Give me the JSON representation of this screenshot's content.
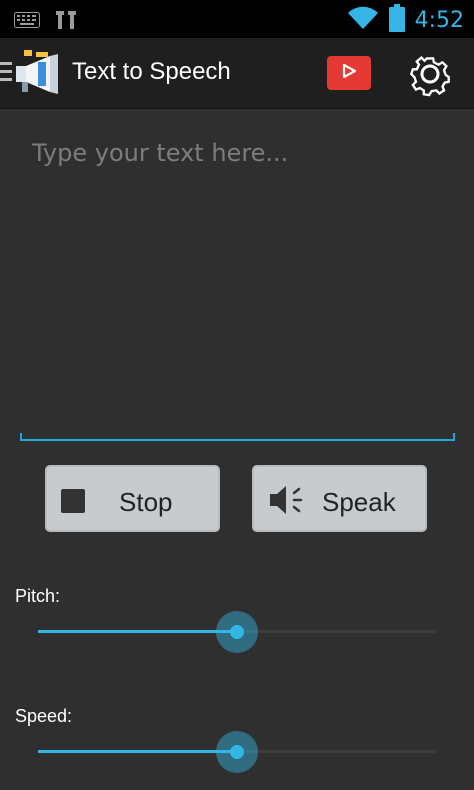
{
  "status": {
    "time": "4:52",
    "icons": [
      "keyboard-icon",
      "usb-debug-icon",
      "wifi-icon",
      "battery-icon"
    ],
    "accent": "#34b5e5"
  },
  "toolbar": {
    "title": "Text to Speech",
    "youtube_color": "#e53935"
  },
  "editor": {
    "placeholder": "Type your text here...",
    "value": "",
    "accent": "#1fa8dc"
  },
  "buttons": {
    "stop_label": "Stop",
    "speak_label": "Speak"
  },
  "sliders": [
    {
      "label": "Pitch:",
      "value": 0.5
    },
    {
      "label": "Speed:",
      "value": 0.5
    }
  ]
}
